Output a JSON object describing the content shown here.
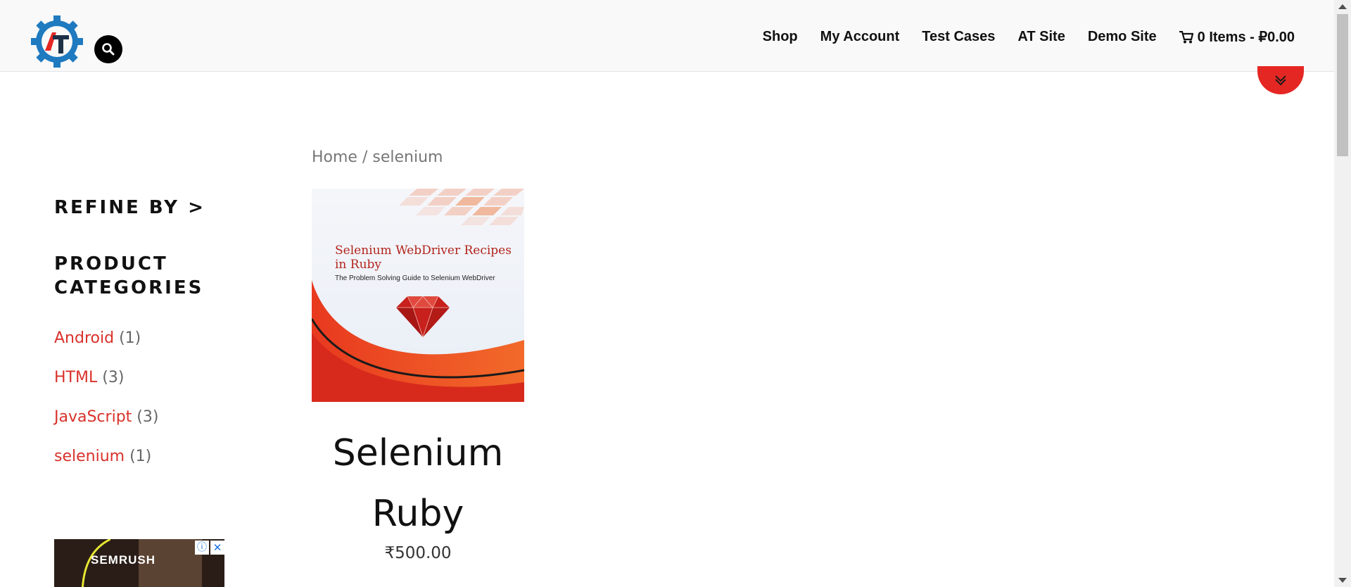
{
  "header": {
    "nav": [
      {
        "label": "Shop"
      },
      {
        "label": "My Account"
      },
      {
        "label": "Test Cases"
      },
      {
        "label": "AT Site"
      },
      {
        "label": "Demo Site"
      }
    ],
    "cart_label": "0 Items - ₽0.00"
  },
  "sidebar": {
    "refine": "REFINE BY >",
    "categories_title": "PRODUCT CATEGORIES",
    "categories": [
      {
        "name": "Android",
        "count": "(1)"
      },
      {
        "name": "HTML",
        "count": "(3)"
      },
      {
        "name": "JavaScript",
        "count": "(3)"
      },
      {
        "name": "selenium",
        "count": "(1)"
      }
    ]
  },
  "ad": {
    "brand": "SEMRUSH",
    "info": "ⓘ",
    "close": "✕"
  },
  "breadcrumb": {
    "home": "Home",
    "separator": " / ",
    "current": "selenium"
  },
  "product": {
    "cover_title": "Selenium WebDriver Recipes in Ruby",
    "cover_subtitle": "The Problem Solving Guide to Selenium WebDriver",
    "title": "Selenium Ruby",
    "price": "₹500.00"
  },
  "colors": {
    "accent": "#e52724",
    "link": "#d9312a",
    "logo_blue": "#1f7ac0"
  }
}
